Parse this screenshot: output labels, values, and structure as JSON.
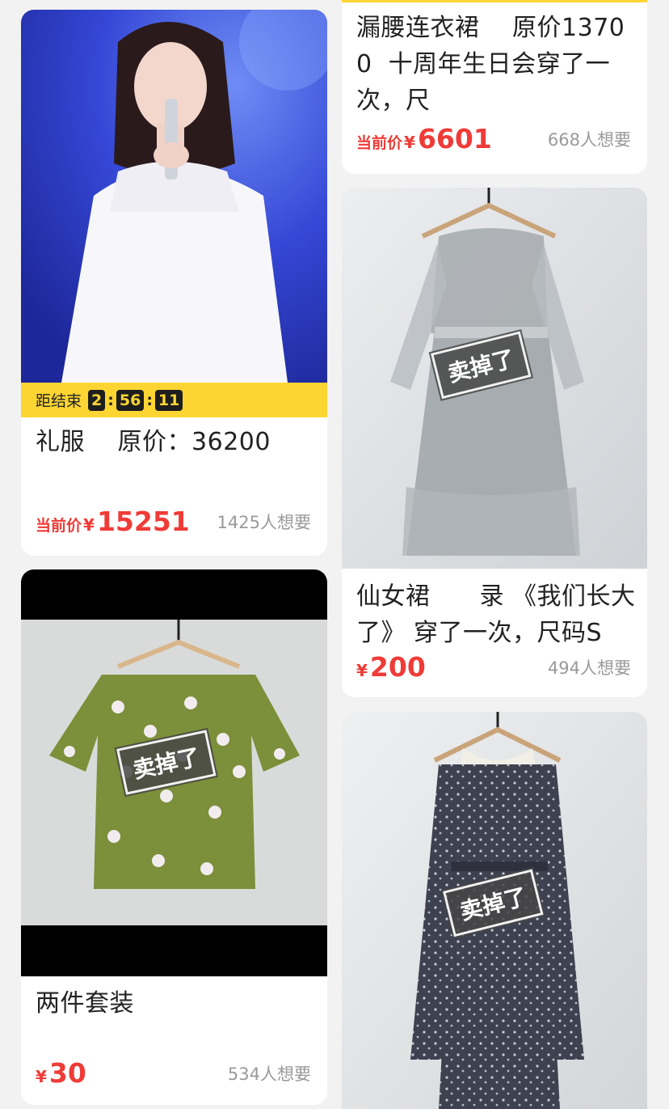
{
  "cards": [
    {
      "title": "礼服　 原价：36200",
      "countdown": {
        "label": "距结束",
        "hours": "2",
        "minutes": "56",
        "seconds": "11"
      },
      "price_label": "当前价",
      "currency": "¥",
      "price": "15251",
      "wants": "1425人想要"
    },
    {
      "title": "漏腰连衣裙　 原价13700  十周年生日会穿了一次，尺",
      "price_label": "当前价",
      "currency": "¥",
      "price": "6601",
      "wants": "668人想要"
    },
    {
      "title": "仙女裙　　录 《我们长大了》 穿了一次，尺码S",
      "currency": "¥",
      "price": "200",
      "wants": "494人想要",
      "sold_label": "卖掉了"
    },
    {
      "title": "两件套装",
      "currency": "¥",
      "price": "30",
      "wants": "534人想要",
      "sold_label": "卖掉了"
    },
    {
      "sold_label": "卖掉了"
    }
  ],
  "colors": {
    "page_bg": "#f2f2f2",
    "price_red": "#ef3b37",
    "countdown_yellow": "#fcd533",
    "muted_gray": "#9a9a9a"
  }
}
